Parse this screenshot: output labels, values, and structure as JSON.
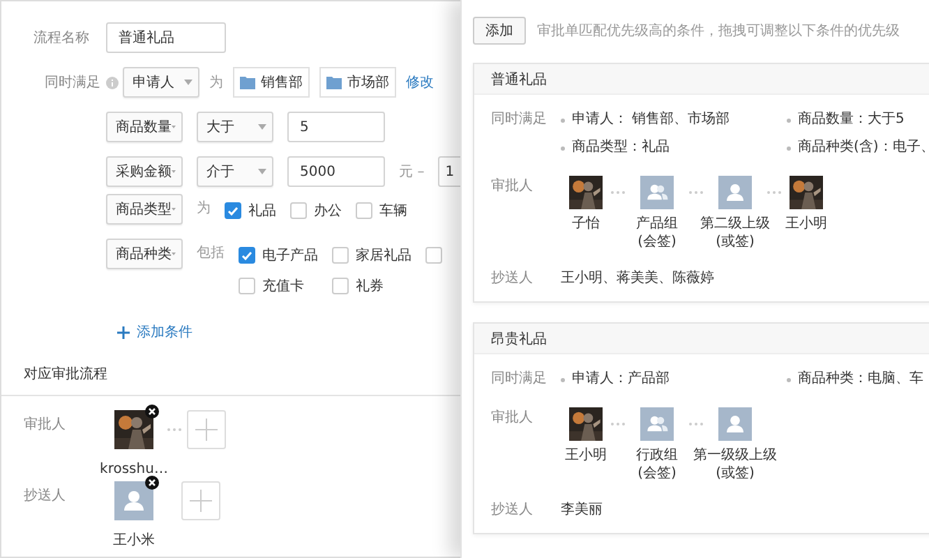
{
  "form": {
    "name_label": "流程名称",
    "name_value": "普通礼品",
    "conditions_label": "同时满足",
    "conditions": [
      {
        "kind": "org",
        "field": "申请人",
        "connector": "为",
        "tags": [
          "销售部",
          "市场部"
        ],
        "link": "修改"
      },
      {
        "kind": "compare",
        "field": "商品数量",
        "operator": "大于",
        "value": "5"
      },
      {
        "kind": "range",
        "field": "采购金额",
        "operator": "介于",
        "value": "5000",
        "unit": "元",
        "dash": "–",
        "value_2": "1"
      },
      {
        "kind": "options",
        "field": "商品类型",
        "connector": "为",
        "options": [
          {
            "label": "礼品",
            "checked": true
          },
          {
            "label": "办公",
            "checked": false
          },
          {
            "label": "车辆",
            "checked": false
          }
        ]
      },
      {
        "kind": "options",
        "field": "商品种类",
        "connector": "包括",
        "options": [
          {
            "label": "电子产品",
            "checked": true
          },
          {
            "label": "家居礼品",
            "checked": false
          },
          {
            "checked": false
          },
          {
            "label": "充值卡",
            "checked": false
          },
          {
            "label": "礼券",
            "checked": false
          }
        ]
      }
    ],
    "add_condition": "添加条件"
  },
  "flow": {
    "title": "对应审批流程",
    "approver_label": "审批人",
    "approvers": [
      {
        "name": "krosshu…",
        "removable": true
      }
    ],
    "cc_label": "抄送人",
    "cc": [
      {
        "name": "王小米",
        "kind": "person",
        "removable": true
      }
    ]
  },
  "rules_panel": {
    "add_button": "添加",
    "hint": "审批单匹配优先级高的条件，拖拽可调整以下条件的优先级",
    "rules": [
      {
        "title": "普通礼品",
        "conditions_label": "同时满足",
        "conditions": [
          "申请人： 销售部、市场部",
          "商品数量：大于5",
          "商品类型：礼品",
          "商品种类(含)：电子、"
        ],
        "approver_label": "审批人",
        "approvers": [
          {
            "name": "子怡"
          },
          {
            "name": "产品组",
            "note": "(会签)",
            "kind": "group"
          },
          {
            "name": "第二级上级",
            "note": "(或签)",
            "kind": "person"
          },
          {
            "name": "王小明"
          }
        ],
        "cc_label": "抄送人",
        "cc": "王小明、蒋美美、陈薇婷"
      },
      {
        "title": "昂贵礼品",
        "conditions_label": "同时满足",
        "conditions": [
          "申请人：产品部",
          "商品种类：电脑、车"
        ],
        "approver_label": "审批人",
        "approvers": [
          {
            "name": "王小明"
          },
          {
            "name": "行政组",
            "note": "(会签)",
            "kind": "group"
          },
          {
            "name": "第一级级上级",
            "note": "(或签)",
            "kind": "person"
          }
        ],
        "cc_label": "抄送人",
        "cc": "李美丽"
      }
    ]
  }
}
